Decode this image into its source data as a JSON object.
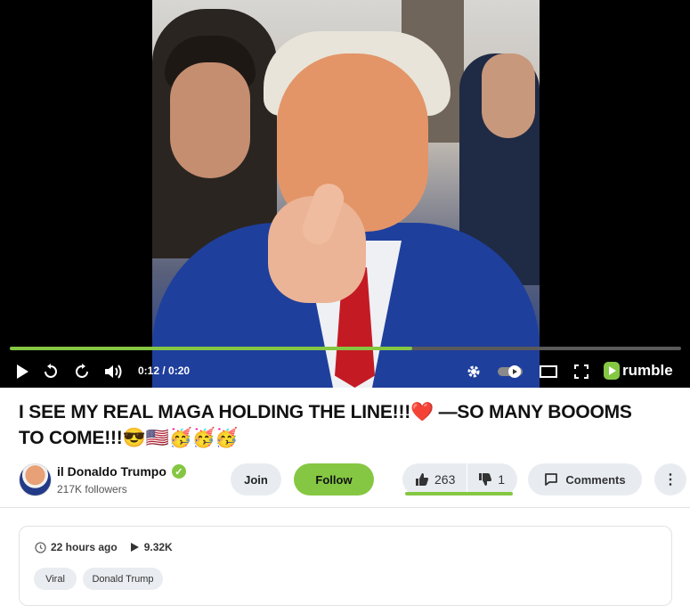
{
  "video": {
    "progress_fraction": 0.6,
    "time_display": "0:12 / 0:20",
    "brand": "rumble"
  },
  "title": "I SEE MY REAL MAGA HOLDING THE LINE!!!❤️ —SO MANY BOOOMS TO COME!!!😎🇺🇸🥳🥳🥳",
  "channel": {
    "name": "il Donaldo Trumpo",
    "followers": "217K followers",
    "join_label": "Join",
    "follow_label": "Follow"
  },
  "engagement": {
    "likes": "263",
    "dislikes": "1",
    "comments_label": "Comments",
    "more_label": "⋮"
  },
  "description": {
    "posted": "22 hours ago",
    "views": "9.32K",
    "tags": [
      "Viral",
      "Donald Trump"
    ]
  },
  "colors": {
    "accent": "#85c742",
    "player_bg": "#000000",
    "pill_bg": "#e8ecf1"
  }
}
